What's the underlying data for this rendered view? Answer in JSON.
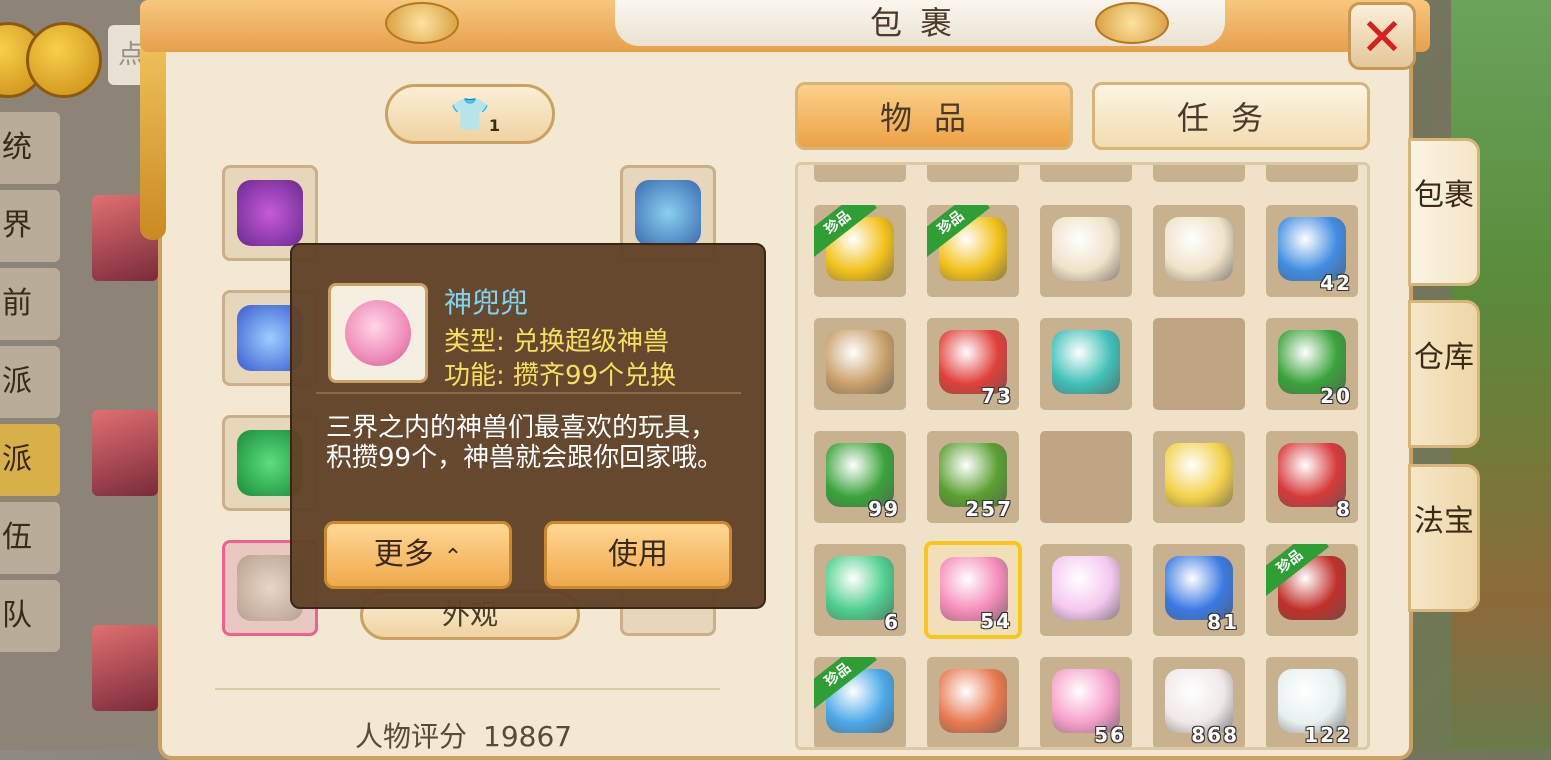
{
  "background": {
    "search_placeholder": "点",
    "side_menu": [
      {
        "label": "统",
        "active": false
      },
      {
        "label": "界",
        "active": false
      },
      {
        "label": "前",
        "active": false
      },
      {
        "label": "派",
        "active": false
      },
      {
        "label": "派",
        "active": true
      },
      {
        "label": "伍",
        "active": false
      },
      {
        "label": "队",
        "active": false
      }
    ]
  },
  "window": {
    "title": "包裹",
    "close_label": "✕"
  },
  "character": {
    "outfit_badge": "1",
    "look_button": "外观",
    "score_label": "人物评分",
    "score_value": "19867"
  },
  "tabs": [
    {
      "label": "物品",
      "active": true
    },
    {
      "label": "任务",
      "active": false
    }
  ],
  "side_tabs": [
    {
      "label": "包裹",
      "active": true
    },
    {
      "label": "仓库",
      "active": false
    },
    {
      "label": "法宝",
      "active": false
    }
  ],
  "rare_tag": "珍品",
  "inventory": [
    {
      "name": "gold-crystal",
      "qty": "",
      "rare": true,
      "color": "#f2c21a"
    },
    {
      "name": "gold-crystal",
      "qty": "",
      "rare": true,
      "color": "#f2c21a"
    },
    {
      "name": "love-letter",
      "qty": "",
      "rare": false,
      "color": "#efe3c8"
    },
    {
      "name": "love-letter",
      "qty": "",
      "rare": false,
      "color": "#efe3c8"
    },
    {
      "name": "blue-gem",
      "qty": "42",
      "rare": false,
      "color": "#3f8de2"
    },
    {
      "name": "book-bundle",
      "qty": "",
      "rare": false,
      "color": "#c9a06a"
    },
    {
      "name": "red-ticket",
      "qty": "73",
      "rare": false,
      "color": "#e0403a"
    },
    {
      "name": "panda-orb",
      "qty": "",
      "rare": false,
      "color": "#3fc0b8"
    },
    {
      "name": "empty",
      "qty": "",
      "rare": false,
      "color": ""
    },
    {
      "name": "green-candy",
      "qty": "20",
      "rare": false,
      "color": "#3aa33a"
    },
    {
      "name": "green-candy",
      "qty": "99",
      "rare": false,
      "color": "#3aa33a"
    },
    {
      "name": "potted-bush",
      "qty": "257",
      "rare": false,
      "color": "#5aa030"
    },
    {
      "name": "empty",
      "qty": "",
      "rare": false,
      "color": ""
    },
    {
      "name": "gold-candy",
      "qty": "",
      "rare": false,
      "color": "#f2d24a"
    },
    {
      "name": "red-dessert",
      "qty": "8",
      "rare": false,
      "color": "#d63a3a"
    },
    {
      "name": "rainbow-leaf",
      "qty": "6",
      "rare": false,
      "color": "#4fcf8f"
    },
    {
      "name": "pocket-toy",
      "qty": "54",
      "rare": false,
      "color": "#f58cb8",
      "selected": true
    },
    {
      "name": "pearl-orb",
      "qty": "",
      "rare": false,
      "color": "#f5c8f0"
    },
    {
      "name": "blue-puzzle",
      "qty": "81",
      "rare": false,
      "color": "#3a7ae2"
    },
    {
      "name": "gift-box",
      "qty": "",
      "rare": true,
      "color": "#c0302a"
    },
    {
      "name": "blue-gift",
      "qty": "",
      "rare": true,
      "color": "#4aa8e8"
    },
    {
      "name": "coin-jar",
      "qty": "",
      "rare": false,
      "color": "#e87a50"
    },
    {
      "name": "pink-orb",
      "qty": "56",
      "rare": false,
      "color": "#f5a0c8"
    },
    {
      "name": "paw-cushion",
      "qty": "868",
      "rare": false,
      "color": "#f0e8e8"
    },
    {
      "name": "paw-cushion-blue",
      "qty": "122",
      "rare": false,
      "color": "#e8f0f0"
    }
  ],
  "tooltip": {
    "item_name": "神兜兜",
    "type_line": "类型: 兑换超级神兽",
    "func_line": "功能: 攒齐99个兑换",
    "description": "三界之内的神兽们最喜欢的玩具，积攒99个，神兽就会跟你回家哦。",
    "more_button": "更多",
    "more_chevron": "⌃",
    "use_button": "使用"
  }
}
